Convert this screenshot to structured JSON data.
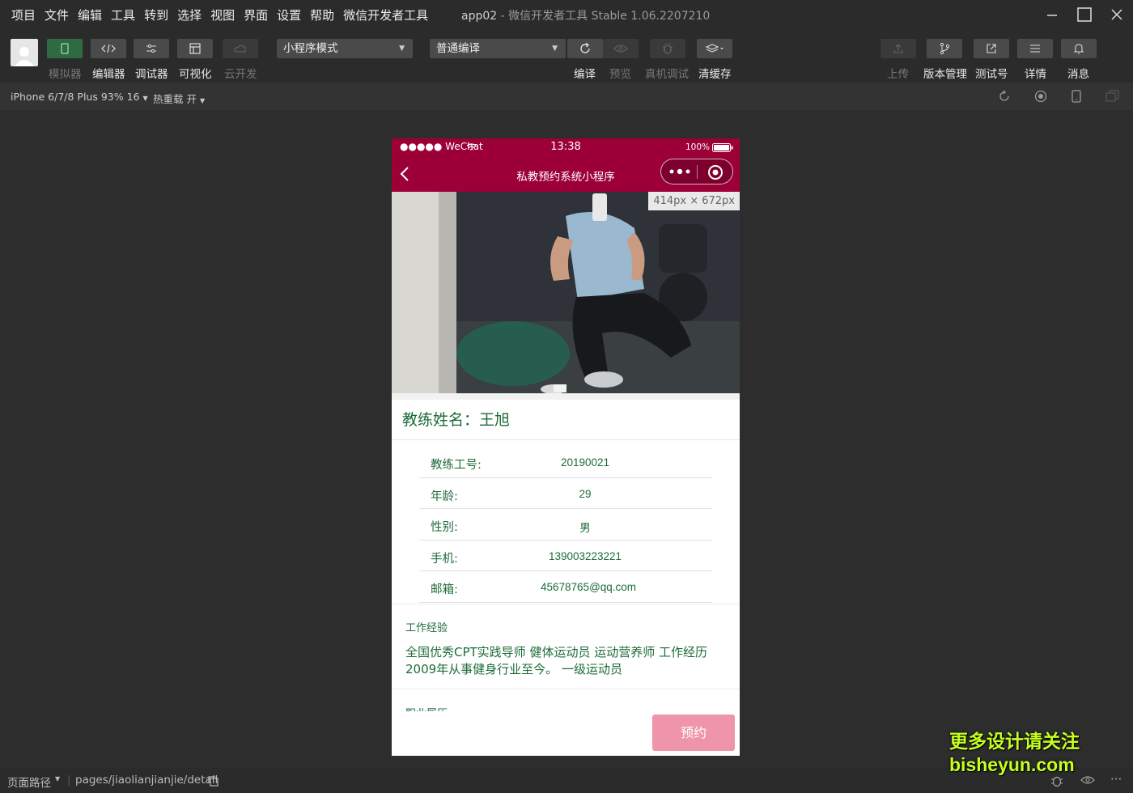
{
  "menu": [
    "项目",
    "文件",
    "编辑",
    "工具",
    "转到",
    "选择",
    "视图",
    "界面",
    "设置",
    "帮助",
    "微信开发者工具"
  ],
  "window": {
    "project": "app02",
    "title": "- 微信开发者工具 Stable 1.06.2207210"
  },
  "toolbar": {
    "left_labels": {
      "simulator": "模拟器",
      "editor": "编辑器",
      "debugger": "调试器",
      "visual": "可视化",
      "cloud": "云开发"
    },
    "mode_select": "小程序模式",
    "compile_select": "普通编译",
    "mid_labels": {
      "compile": "编译",
      "preview": "预览",
      "remote_debug": "真机调试",
      "clear_cache": "清缓存"
    },
    "right_labels": {
      "upload": "上传",
      "version": "版本管理",
      "test": "测试号",
      "details": "详情",
      "messages": "消息"
    }
  },
  "subbar": {
    "device": "iPhone 6/7/8 Plus 93% 16",
    "hot_reload": "热重载 开"
  },
  "phone": {
    "status": {
      "carrier": "●●●●● WeChat",
      "time": "13:38",
      "battery": "100%"
    },
    "nav_title": "私教预约系统小程序",
    "image_size": "414px × 672px",
    "coach_name": "教练姓名：王旭",
    "rows": [
      {
        "k": "教练工号:",
        "v": "20190021"
      },
      {
        "k": "年龄:",
        "v": "29"
      },
      {
        "k": "性别:",
        "v": "男"
      },
      {
        "k": "手机:",
        "v": "139003223221"
      },
      {
        "k": "邮箱:",
        "v": "45678765@qq.com"
      }
    ],
    "exp_title": "工作经验",
    "exp_content": "全国优秀CPT实践导师 健体运动员 运动营养师  工作经历2009年从事健身行业至今。  一级运动员",
    "exp2_title": "职业履历",
    "book_button": "预约"
  },
  "bottombar": {
    "path_label": "页面路径",
    "path": "pages/jiaolianjianjie/detail"
  },
  "watermark": {
    "line1": "更多设计请关注",
    "line2": "bisheyun.com"
  },
  "colors": {
    "nav": "#9c0036",
    "text_green": "#1d6b38",
    "book": "#ef95a9"
  }
}
